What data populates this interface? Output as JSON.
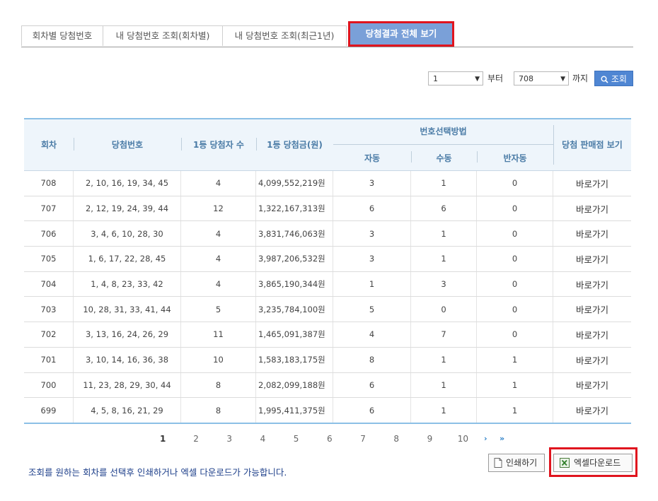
{
  "tabs": [
    {
      "label": "회차별 당첨번호"
    },
    {
      "label": "내 당첨번호 조회(회차별)"
    },
    {
      "label": "내 당첨번호 조회(최근1년)"
    },
    {
      "label": "당첨결과 전체 보기",
      "active": true
    }
  ],
  "range": {
    "from_value": "1",
    "from_label": "부터",
    "to_value": "708",
    "to_label": "까지",
    "search_label": "조회"
  },
  "table": {
    "headers": {
      "round": "회차",
      "numbers": "당첨번호",
      "winners": "1등 당첨자 수",
      "amount": "1등 당첨금(원)",
      "method": "번호선택방법",
      "auto": "자동",
      "manual": "수동",
      "semi": "반자동",
      "shop": "당첨 판매점 보기"
    },
    "rows": [
      {
        "round": "708",
        "numbers": "2, 10, 16, 19, 34, 45",
        "winners": "4",
        "amount": "4,099,552,219원",
        "auto": "3",
        "manual": "1",
        "semi": "0",
        "shop": "바로가기"
      },
      {
        "round": "707",
        "numbers": "2, 12, 19, 24, 39, 44",
        "winners": "12",
        "amount": "1,322,167,313원",
        "auto": "6",
        "manual": "6",
        "semi": "0",
        "shop": "바로가기"
      },
      {
        "round": "706",
        "numbers": "3, 4, 6, 10, 28, 30",
        "winners": "4",
        "amount": "3,831,746,063원",
        "auto": "3",
        "manual": "1",
        "semi": "0",
        "shop": "바로가기"
      },
      {
        "round": "705",
        "numbers": "1, 6, 17, 22, 28, 45",
        "winners": "4",
        "amount": "3,987,206,532원",
        "auto": "3",
        "manual": "1",
        "semi": "0",
        "shop": "바로가기"
      },
      {
        "round": "704",
        "numbers": "1, 4, 8, 23, 33, 42",
        "winners": "4",
        "amount": "3,865,190,344원",
        "auto": "1",
        "manual": "3",
        "semi": "0",
        "shop": "바로가기"
      },
      {
        "round": "703",
        "numbers": "10, 28, 31, 33, 41, 44",
        "winners": "5",
        "amount": "3,235,784,100원",
        "auto": "5",
        "manual": "0",
        "semi": "0",
        "shop": "바로가기"
      },
      {
        "round": "702",
        "numbers": "3, 13, 16, 24, 26, 29",
        "winners": "11",
        "amount": "1,465,091,387원",
        "auto": "4",
        "manual": "7",
        "semi": "0",
        "shop": "바로가기"
      },
      {
        "round": "701",
        "numbers": "3, 10, 14, 16, 36, 38",
        "winners": "10",
        "amount": "1,583,183,175원",
        "auto": "8",
        "manual": "1",
        "semi": "1",
        "shop": "바로가기"
      },
      {
        "round": "700",
        "numbers": "11, 23, 28, 29, 30, 44",
        "winners": "8",
        "amount": "2,082,099,188원",
        "auto": "6",
        "manual": "1",
        "semi": "1",
        "shop": "바로가기"
      },
      {
        "round": "699",
        "numbers": "4, 5, 8, 16, 21, 29",
        "winners": "8",
        "amount": "1,995,411,375원",
        "auto": "6",
        "manual": "1",
        "semi": "1",
        "shop": "바로가기"
      }
    ]
  },
  "pagination": {
    "pages": [
      "1",
      "2",
      "3",
      "4",
      "5",
      "6",
      "7",
      "8",
      "9",
      "10"
    ],
    "current": "1",
    "next": "›",
    "last": "»"
  },
  "footer": {
    "note": "조회를 원하는 회차를 선택후 인쇄하거나 엑셀 다운로드가 가능합니다.",
    "print_label": "인쇄하기",
    "excel_label": "엑셀다운로드"
  },
  "colors": {
    "accent": "#4f86d3",
    "active_tab": "#7aa0d8",
    "highlight_border": "#e0141e",
    "header_text": "#4a7ba6"
  }
}
